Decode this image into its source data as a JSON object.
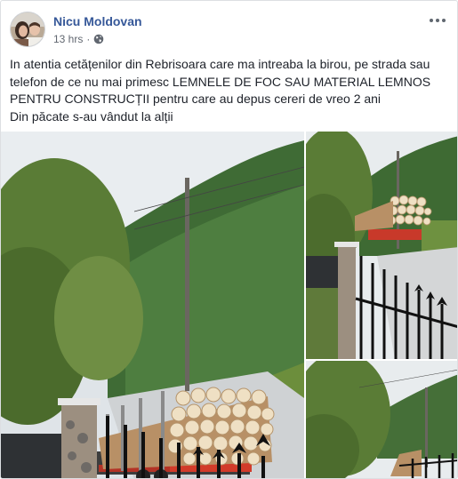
{
  "post": {
    "author": "Nicu Moldovan",
    "timestamp": "13 hrs",
    "separator": "·",
    "privacy_icon": "globe-icon",
    "more_icon": "more-options-icon",
    "text_lines": [
      "In atentia cetățenilor din Rebrisoara care ma intreaba la birou, pe strada sau telefon de ce nu mai primesc LEMNELE DE FOC SAU MATERIAL LEMNOS PENTRU CONSTRUCȚII pentru care au depus cereri de vreo 2 ani",
      "Din păcate s-au vândut la alții"
    ]
  },
  "colors": {
    "author_link": "#365899",
    "meta_text": "#616770",
    "body_text": "#1d2129"
  }
}
